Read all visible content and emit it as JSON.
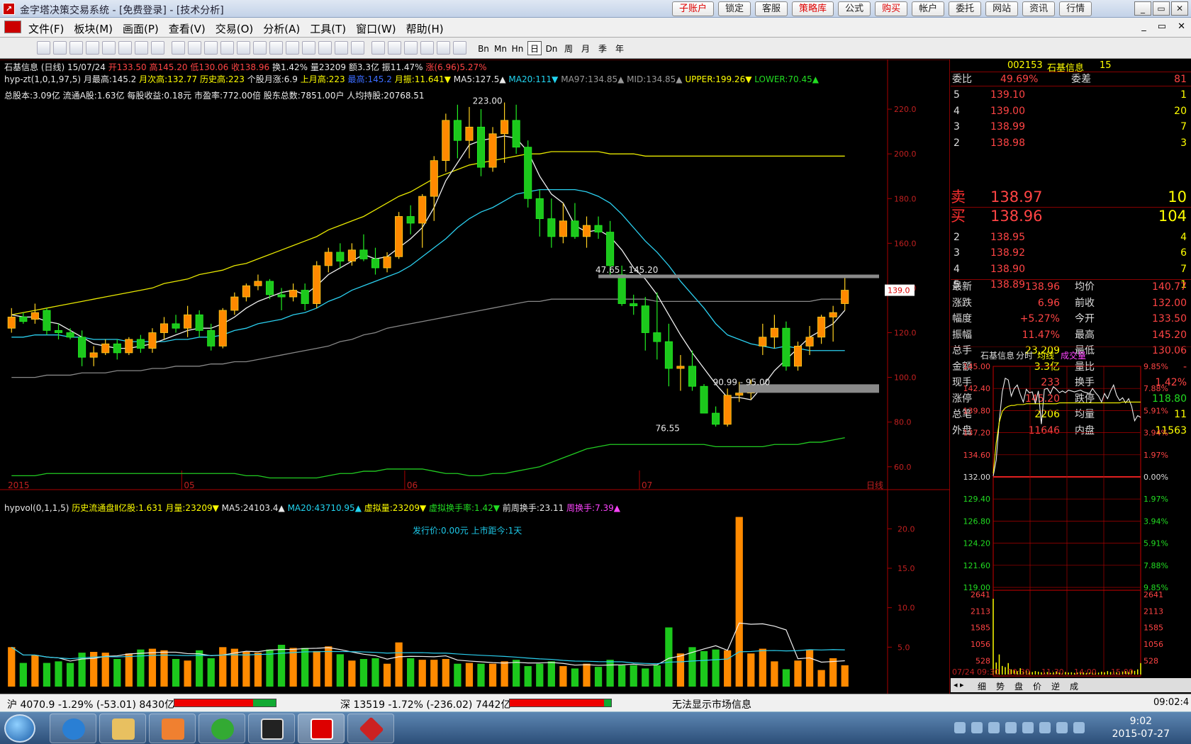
{
  "window": {
    "title": "金字塔决策交易系统 - [免费登录] - [技术分析]",
    "buttons": [
      "子账户",
      "锁定",
      "客服",
      "策略库",
      "公式",
      "购买",
      "帐户",
      "委托",
      "网站",
      "资讯",
      "行情"
    ],
    "red_buttons": [
      "子账户",
      "策略库",
      "购买"
    ],
    "controls": [
      "_",
      "▭",
      "✕"
    ]
  },
  "menu": {
    "items": [
      "文件(F)",
      "板块(M)",
      "画面(P)",
      "查看(V)",
      "交易(O)",
      "分析(A)",
      "工具(T)",
      "窗口(W)",
      "帮助(H)"
    ],
    "mdi": [
      "_",
      "▭",
      "✕"
    ]
  },
  "toolbar": {
    "periods": [
      "Bn",
      "Mn",
      "Hn",
      "日",
      "Dn",
      "周",
      "月",
      "季",
      "年"
    ],
    "selected": "日"
  },
  "stock": {
    "code": "002153",
    "name": "石基信息",
    "level": "15"
  },
  "info_line1": [
    {
      "t": "石基信息 (日线)  15/07/24  ",
      "c": "#e8e8e8"
    },
    {
      "t": "开133.50",
      "c": "#ff4444"
    },
    {
      "t": "  高145.20",
      "c": "#ff4444"
    },
    {
      "t": "  低130.06",
      "c": "#ff4444"
    },
    {
      "t": "  收138.96",
      "c": "#ff4444"
    },
    {
      "t": "  换1.42%  量23209  额3.3亿  振11.47%  ",
      "c": "#e8e8e8"
    },
    {
      "t": "涨(6.96)5.27%",
      "c": "#ff4444"
    }
  ],
  "info_line2": [
    {
      "t": "hyp-zt(1,0,1,97,5)  ",
      "c": "#e8e8e8"
    },
    {
      "t": "月最高:145.2  ",
      "c": "#e8e8e8"
    },
    {
      "t": "月次高:132.77  ",
      "c": "#ffff00"
    },
    {
      "t": "历史高:223  ",
      "c": "#ffff00"
    },
    {
      "t": "个股月涨:6.9  ",
      "c": "#e8e8e8"
    },
    {
      "t": "上月高:223  ",
      "c": "#ffff00"
    },
    {
      "t": "最高:145.2  ",
      "c": "#3b6cff"
    },
    {
      "t": "月振:11.641▼  ",
      "c": "#ffff00"
    },
    {
      "t": "MA5:127.5▲  ",
      "c": "#e8e8e8"
    },
    {
      "t": "MA20:111▼  ",
      "c": "#22d4f0"
    },
    {
      "t": "MA97:134.85▲  ",
      "c": "#999999"
    },
    {
      "t": "MID:134.85▲  ",
      "c": "#999999"
    },
    {
      "t": "UPPER:199.26▼  ",
      "c": "#ffff00"
    },
    {
      "t": "LOWER:70.45▲",
      "c": "#22dd22"
    }
  ],
  "info_line3": "总股本:3.09亿  流通A股:1.63亿   每股收益:0.18元  市盈率:772.00倍  股东总数:7851.00户  人均持股:20768.51",
  "vol_line": [
    {
      "t": "hypvol(0,1,1,5)  ",
      "c": "#e8e8e8"
    },
    {
      "t": "历史流通盘Ⅱ亿股:1.631  ",
      "c": "#ffff00"
    },
    {
      "t": "月量:23209▼  ",
      "c": "#ffff00"
    },
    {
      "t": "MA5:24103.4▲  ",
      "c": "#e8e8e8"
    },
    {
      "t": "MA20:43710.95▲  ",
      "c": "#22d4f0"
    },
    {
      "t": "虚拟量:23209▼  ",
      "c": "#ffff00"
    },
    {
      "t": "虚拟换手率:1.42▼  ",
      "c": "#22dd22"
    },
    {
      "t": "前周换手:23.11  ",
      "c": "#e8e8e8"
    },
    {
      "t": "周换手:7.39▲",
      "c": "#ff44ff"
    }
  ],
  "ipo_text": "发行价:0.00元  上市距今:1天",
  "chart_data": {
    "type": "candlestick",
    "price_ticks": [
      220,
      200,
      180,
      160,
      140,
      120,
      100,
      80,
      60
    ],
    "price_ylim": [
      52,
      227
    ],
    "x_labels": [
      "2015",
      "05",
      "06",
      "07"
    ],
    "x_label_bars": [
      0,
      15,
      34,
      54
    ],
    "period_label": "日线",
    "annotations": [
      {
        "text": "223.00",
        "bar": 42,
        "price": 223
      },
      {
        "text": "47.65 - 145.20",
        "bar": 50,
        "price": 145.2
      },
      {
        "text": "90.99 - 95.00",
        "bar": 60,
        "price": 95
      },
      {
        "text": "76.55",
        "bar": 58,
        "price": 76.55
      }
    ],
    "current_price": "139.0",
    "candles": [
      [
        122,
        131,
        120,
        127
      ],
      [
        127,
        129,
        124,
        125
      ],
      [
        126,
        133,
        124,
        129
      ],
      [
        130,
        131,
        119,
        121
      ],
      [
        121,
        124,
        117,
        120
      ],
      [
        120,
        122,
        117,
        118
      ],
      [
        118,
        121,
        105,
        109
      ],
      [
        109,
        114,
        105,
        111
      ],
      [
        111,
        117,
        110,
        115
      ],
      [
        115,
        117,
        108,
        111
      ],
      [
        111,
        118,
        110,
        117
      ],
      [
        117,
        119,
        111,
        113
      ],
      [
        113,
        122,
        111,
        120
      ],
      [
        120,
        127,
        117,
        124
      ],
      [
        124,
        128,
        120,
        122
      ],
      [
        122,
        132,
        118,
        128
      ],
      [
        128,
        130,
        118,
        121
      ],
      [
        121,
        124,
        112,
        114
      ],
      [
        114,
        131,
        113,
        130
      ],
      [
        130,
        138,
        128,
        136
      ],
      [
        136,
        142,
        134,
        141
      ],
      [
        141,
        146,
        139,
        143
      ],
      [
        143,
        144,
        135,
        137
      ],
      [
        137,
        140,
        130,
        136
      ],
      [
        136,
        142,
        134,
        139
      ],
      [
        139,
        142,
        130,
        133
      ],
      [
        133,
        152,
        131,
        150
      ],
      [
        150,
        158,
        147,
        156
      ],
      [
        156,
        160,
        149,
        152
      ],
      [
        152,
        160,
        150,
        157
      ],
      [
        157,
        164,
        152,
        153
      ],
      [
        153,
        158,
        146,
        149
      ],
      [
        149,
        156,
        147,
        154
      ],
      [
        154,
        174,
        153,
        172
      ],
      [
        172,
        177,
        164,
        169
      ],
      [
        169,
        182,
        158,
        181
      ],
      [
        181,
        199,
        170,
        197
      ],
      [
        197,
        218,
        192,
        215
      ],
      [
        215,
        222,
        198,
        206
      ],
      [
        206,
        221,
        198,
        212
      ],
      [
        212,
        220,
        190,
        194
      ],
      [
        194,
        212,
        192,
        209
      ],
      [
        209,
        223,
        196,
        215
      ],
      [
        215,
        222,
        200,
        203
      ],
      [
        203,
        206,
        176,
        180
      ],
      [
        180,
        184,
        163,
        171
      ],
      [
        171,
        180,
        158,
        163
      ],
      [
        163,
        178,
        160,
        170
      ],
      [
        170,
        178,
        162,
        163
      ],
      [
        163,
        172,
        158,
        168
      ],
      [
        168,
        172,
        162,
        165
      ],
      [
        165,
        170,
        146,
        150
      ],
      [
        146,
        150,
        132,
        133
      ],
      [
        133,
        137,
        128,
        132
      ],
      [
        132,
        136,
        112,
        120
      ],
      [
        120,
        138,
        108,
        116
      ],
      [
        116,
        124,
        96,
        104
      ],
      [
        104,
        110,
        94,
        105
      ],
      [
        105,
        112,
        94,
        96
      ],
      [
        96,
        97,
        86,
        84
      ],
      [
        84,
        87,
        78,
        79
      ],
      [
        79,
        95,
        78,
        92
      ],
      [
        92,
        98,
        89,
        93
      ],
      [
        93,
        99,
        90,
        94
      ],
      [
        114,
        124,
        110,
        118
      ],
      [
        118,
        128,
        113,
        122
      ],
      [
        122,
        125,
        103,
        105
      ],
      [
        105,
        116,
        103,
        114
      ],
      [
        114,
        123,
        110,
        118
      ],
      [
        118,
        128,
        115,
        127
      ],
      [
        127,
        132,
        116,
        129
      ],
      [
        133,
        145,
        130,
        139
      ]
    ],
    "ma5": [
      128,
      127,
      127,
      125,
      124,
      121,
      118,
      115,
      114,
      113,
      113,
      114,
      115,
      117,
      119,
      121,
      122,
      122,
      124,
      127,
      131,
      134,
      136,
      138,
      139,
      137,
      141,
      146,
      149,
      152,
      155,
      153,
      154,
      158,
      162,
      167,
      176,
      188,
      196,
      204,
      206,
      207,
      208,
      207,
      201,
      190,
      182,
      178,
      168,
      165,
      166,
      163,
      157,
      149,
      144,
      137,
      128,
      119,
      111,
      104,
      97,
      91,
      91,
      90,
      96,
      103,
      108,
      113,
      118,
      121,
      124,
      130
    ],
    "ma20": [
      118,
      118,
      119,
      119,
      119,
      118,
      118,
      117,
      117,
      117,
      116,
      116,
      116,
      116,
      117,
      117,
      118,
      118,
      119,
      121,
      122,
      124,
      125,
      126,
      128,
      129,
      131,
      134,
      136,
      139,
      141,
      143,
      145,
      147,
      150,
      154,
      158,
      162,
      167,
      171,
      174,
      176,
      179,
      182,
      183,
      184,
      184,
      184,
      184,
      183,
      181,
      178,
      173,
      167,
      161,
      156,
      150,
      143,
      137,
      131,
      124,
      119,
      117,
      115,
      114,
      113,
      114,
      113,
      112,
      112,
      112,
      112
    ],
    "ma97": [
      100,
      100,
      100,
      101,
      101,
      101,
      102,
      102,
      102,
      103,
      103,
      103,
      104,
      104,
      105,
      105,
      105,
      106,
      106,
      107,
      107,
      108,
      109,
      110,
      111,
      112,
      113,
      114,
      116,
      117,
      119,
      120,
      122,
      123,
      124,
      125,
      126,
      127,
      128,
      129,
      130,
      131,
      132,
      133,
      134,
      134,
      135,
      135,
      135,
      135,
      135,
      135,
      135,
      135,
      135,
      134,
      134,
      134,
      134,
      134,
      134,
      134,
      134,
      134,
      134,
      134,
      134,
      134,
      134,
      135,
      135,
      135
    ],
    "upper": [
      128,
      129,
      130,
      131,
      132,
      133,
      134,
      135,
      136,
      137,
      138,
      139,
      140,
      142,
      143,
      144,
      146,
      147,
      148,
      150,
      151,
      153,
      155,
      157,
      159,
      161,
      163,
      166,
      168,
      170,
      172,
      175,
      178,
      181,
      183,
      186,
      189,
      191,
      193,
      195,
      196,
      197,
      198,
      199,
      200,
      200,
      201,
      201,
      201,
      201,
      201,
      200,
      200,
      200,
      199,
      199,
      199,
      199,
      199,
      199,
      199,
      199,
      199,
      199,
      199,
      199,
      199,
      199,
      199,
      199,
      199,
      199
    ],
    "lower": [
      56,
      56,
      56,
      57,
      57,
      57,
      57,
      57,
      57,
      57,
      57,
      57,
      57,
      57,
      57,
      57,
      57,
      57,
      57,
      57,
      56,
      56,
      55,
      55,
      55,
      55,
      55,
      56,
      57,
      57,
      58,
      58,
      59,
      59,
      59,
      59,
      58,
      57,
      57,
      56,
      56,
      57,
      57,
      58,
      59,
      60,
      62,
      64,
      66,
      68,
      69,
      70,
      70,
      70,
      70,
      70,
      70,
      70,
      70,
      70,
      69,
      69,
      69,
      69,
      69,
      70,
      70,
      70,
      71,
      71,
      72,
      73
    ],
    "volume_ticks": [
      20,
      15,
      10,
      5
    ],
    "volume_ylim": [
      0,
      22
    ],
    "volumes": [
      5,
      3,
      4,
      3,
      3.2,
      3,
      4.3,
      4.4,
      4.3,
      3.5,
      4.2,
      4.7,
      4.8,
      4.6,
      3.5,
      3.3,
      4.6,
      3.6,
      5,
      4.8,
      4.4,
      4.3,
      4.7,
      5.3,
      4.9,
      4.9,
      4.5,
      5.1,
      4.1,
      3.3,
      3.5,
      3.6,
      2.9,
      5.6,
      3.6,
      3.4,
      3.4,
      3.5,
      2.9,
      3,
      2.9,
      2.9,
      3.2,
      3.4,
      2.6,
      2.9,
      3.2,
      2.6,
      2.3,
      2.9,
      2.5,
      3.4,
      2.7,
      2.7,
      2.3,
      2.7,
      7.5,
      4.2,
      5,
      4.5,
      4.7,
      4.6,
      21.5,
      4.2,
      4.8,
      3.2,
      2.2,
      3.3,
      4.7,
      2.1,
      3.6,
      2.7
    ]
  },
  "quote": {
    "weibi_label": "委比",
    "weibi": "49.69%",
    "weicha_label": "委差",
    "weicha": "81",
    "sell": [
      {
        "lvl": "5",
        "p": "139.10",
        "v": "1"
      },
      {
        "lvl": "4",
        "p": "139.00",
        "v": "20"
      },
      {
        "lvl": "3",
        "p": "138.99",
        "v": "7"
      },
      {
        "lvl": "2",
        "p": "138.98",
        "v": "3"
      },
      {
        "lvl": "卖",
        "p": "138.97",
        "v": "10"
      }
    ],
    "buy": [
      {
        "lvl": "买",
        "p": "138.96",
        "v": "104"
      },
      {
        "lvl": "2",
        "p": "138.95",
        "v": "4"
      },
      {
        "lvl": "3",
        "p": "138.92",
        "v": "6"
      },
      {
        "lvl": "4",
        "p": "138.90",
        "v": "7"
      },
      {
        "lvl": "5",
        "p": "138.89",
        "v": "1"
      }
    ],
    "stats": [
      [
        "最新",
        "138.96",
        "均价",
        "140.77"
      ],
      [
        "涨跌",
        "6.96",
        "前收",
        "132.00"
      ],
      [
        "幅度",
        "+5.27%",
        "今开",
        "133.50"
      ],
      [
        "振幅",
        "11.47%",
        "最高",
        "145.20"
      ],
      [
        "总手",
        "23,209",
        "最低",
        "130.06"
      ],
      [
        "金额",
        "3.3亿",
        "量比",
        "-"
      ],
      [
        "现手",
        "233",
        "换手",
        "1.42%"
      ],
      [
        "涨停",
        "145.20",
        "跌停",
        "118.80"
      ],
      [
        "总笔",
        "2206",
        "均量",
        "11"
      ],
      [
        "外盘",
        "11646",
        "内盘",
        "11563"
      ]
    ]
  },
  "intraday": {
    "header": [
      "石基信息",
      "分时",
      "均线",
      "成交量"
    ],
    "price_labels": [
      "145.00",
      "142.40",
      "139.80",
      "137.20",
      "134.60",
      "132.00",
      "129.40",
      "126.80",
      "124.20",
      "121.60",
      "119.00"
    ],
    "pct_labels": [
      "9.85%",
      "7.88%",
      "5.91%",
      "3.94%",
      "1.97%",
      "0.00%",
      "1.97%",
      "3.94%",
      "5.91%",
      "7.88%",
      "9.85%"
    ],
    "vol_labels": [
      "2641",
      "2113",
      "1585",
      "1056",
      "528"
    ],
    "time_labels": [
      "07/24",
      "09:30",
      "10:30",
      "11:30",
      "14:00",
      "15:00"
    ],
    "tabs": [
      "细",
      "势",
      "盘",
      "价",
      "逆",
      "成"
    ],
    "price": [
      132.1,
      134,
      138.5,
      142,
      143.6,
      143.4,
      141.5,
      142.4,
      142.8,
      141.7,
      140.8,
      142.3,
      141.9,
      142,
      140.6,
      142.1,
      138.2,
      142.3,
      142.4,
      141.8,
      142.6,
      142.3,
      141.9,
      142.1,
      141.9,
      142.2,
      142.1,
      142,
      142.1,
      142.2,
      142,
      141.9,
      141.8,
      142.4,
      141.9,
      141.5,
      140.8,
      141.8,
      141.2,
      142.1,
      142.8,
      141.6,
      141,
      141.3,
      140.7,
      141.2,
      140.3,
      138.6,
      139.2,
      139
    ],
    "avg": [
      132.4,
      136,
      138.4,
      139.7,
      140.1,
      140.3,
      140.4,
      140.4,
      140.5,
      140.5,
      140.5,
      140.6,
      140.6,
      140.6,
      140.6,
      140.6,
      140.6,
      140.6,
      140.6,
      140.6,
      140.6,
      140.6,
      140.7,
      140.7,
      140.7,
      140.7,
      140.7,
      140.7,
      140.7,
      140.7,
      140.7,
      140.7,
      140.7,
      140.7,
      140.7,
      140.7,
      140.7,
      140.7,
      140.7,
      140.7,
      140.7,
      140.7,
      140.7,
      140.8,
      140.8,
      140.8,
      140.8,
      140.8,
      140.8,
      140.8
    ],
    "vol": [
      2641,
      420,
      700,
      300,
      260,
      400,
      180,
      150,
      120,
      220,
      90,
      140,
      110,
      90,
      120,
      100,
      80,
      70,
      90,
      60,
      80,
      110,
      70,
      60,
      90,
      70,
      80,
      60,
      70,
      90,
      80,
      60,
      70,
      80,
      90,
      70,
      100,
      80,
      120,
      90,
      110,
      80,
      90,
      100,
      120,
      90,
      150,
      130,
      180,
      400
    ]
  },
  "statusbar": {
    "sh": "沪 4070.9 -1.29% (-53.01) 8430亿",
    "sz": "深 13519 -1.72% (-236.02) 7442亿",
    "msg": "无法显示市场信息",
    "time": "09:02:4"
  },
  "taskbar": {
    "time": "9:02",
    "date": "2015-07-27"
  }
}
